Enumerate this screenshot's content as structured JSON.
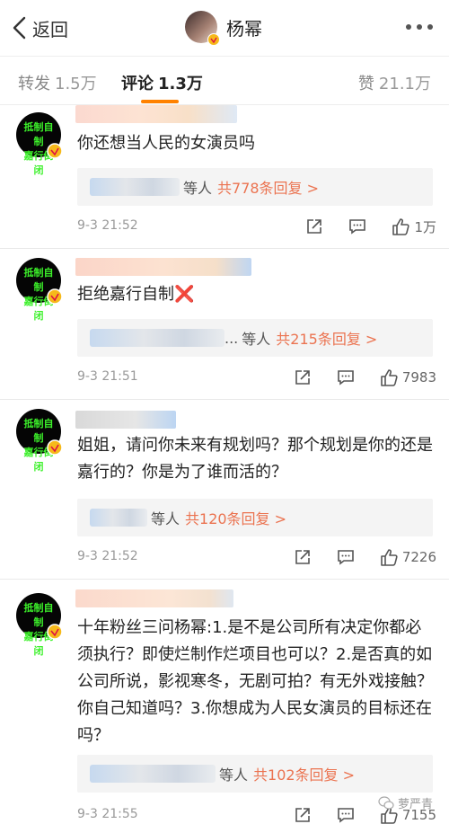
{
  "header": {
    "back_label": "返回",
    "title": "杨幂"
  },
  "tabs": {
    "repost": {
      "label": "转发",
      "count": "1.5万"
    },
    "comment": {
      "label": "评论",
      "count": "1.3万"
    },
    "like": {
      "label": "赞",
      "count": "21.1万"
    }
  },
  "avatar_text": [
    "抵制自制",
    "嘉行倒闭"
  ],
  "comments": [
    {
      "text": "你还想当人民的女演员吗",
      "replies_suffix": "等人",
      "replies_count": "共778条回复 >",
      "time": "9-3 21:52",
      "likes": "1万"
    },
    {
      "text": "拒绝嘉行自制❌",
      "replies_prefix": "...",
      "replies_suffix": "等人",
      "replies_count": "共215条回复 >",
      "time": "9-3 21:51",
      "likes": "7983"
    },
    {
      "text": "姐姐，请问你未来有规划吗？那个规划是你的还是嘉行的？你是为了谁而活的？",
      "replies_suffix": "等人",
      "replies_count": "共120条回复 >",
      "time": "9-3 21:52",
      "likes": "7226"
    },
    {
      "text": "十年粉丝三问杨幂:1.是不是公司所有决定你都必须执行？即使烂制作烂项目也可以？2.是否真的如公司所说，影视寒冬，无剧可拍？有无外戏接触？你自己知道吗？3.你想成为人民女演员的目标还在吗？",
      "replies_suffix": "等人",
      "replies_count": "共102条回复 >",
      "time": "9-3 21:55",
      "likes": "7155"
    }
  ],
  "watermark": "萝严青",
  "colors": {
    "accent": "#ff8200",
    "reply_link": "#eb7350",
    "avatar_text": "#3cf02a",
    "verified": "#f6b91a"
  }
}
